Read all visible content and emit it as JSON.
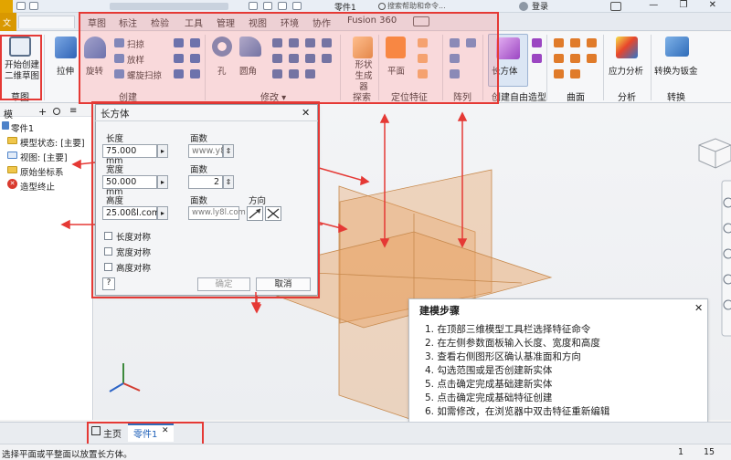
{
  "title_bar": {
    "doc_title": "零件1",
    "search_placeholder": "搜索帮助和命令...",
    "login": "登录",
    "window_controls": "— ❐ ✕"
  },
  "tabs": [
    "草图",
    "标注",
    "检验",
    "工具",
    "管理",
    "视图",
    "环境",
    "协作",
    "Fusion 360"
  ],
  "ribbon": {
    "sketch": {
      "button": "开始创建\n二维草图",
      "group": "草图"
    },
    "create": {
      "extrude": "拉伸",
      "revolve": "旋转",
      "sweep": "扫掠",
      "loft": "放样",
      "coil": "螺旋扫掠",
      "group": "创建"
    },
    "modify": {
      "hole": "孔",
      "fillet": "圆角",
      "group": "修改 ▾"
    },
    "explore": {
      "shape_gen": "形状\n生成器",
      "group": "探索"
    },
    "work": {
      "plane": "平面",
      "group": "定位特征"
    },
    "pattern": {
      "group": "阵列"
    },
    "freeform": {
      "box": "长方体",
      "group": "创建自由造型"
    },
    "surface": {
      "group": "曲面"
    },
    "analysis": {
      "stress": "应力分析",
      "group": "分析"
    },
    "convert": {
      "sheet": "转换为钣金",
      "group": "转换"
    }
  },
  "browser": {
    "tree": [
      {
        "label": "零件1"
      },
      {
        "label": "模型状态: [主要]"
      },
      {
        "label": "视图: [主要]"
      },
      {
        "label": "原始坐标系"
      },
      {
        "label": "造型终止"
      }
    ]
  },
  "dialog": {
    "title": "长方体",
    "length_label": "长度",
    "length_value": "75.000 mm",
    "length_face_label": "面数",
    "length_faces": "www.y8",
    "width_label": "宽度",
    "width_value": "50.000 mm",
    "width_face_label": "面数",
    "width_faces": "2",
    "height_label": "高度",
    "height_value": "25.00ßl.com",
    "height_face_label": "面数",
    "height_faces": "www.ly8l.com",
    "direction_label": "方向",
    "checks": [
      "长度对称",
      "宽度对称",
      "高度对称"
    ],
    "ok": "确定",
    "cancel": "取消"
  },
  "steps": {
    "title": "建模步骤",
    "items": [
      "1. 在顶部三维模型工具栏选择特征命令",
      "2. 在左侧参数面板输入长度、宽度和高度",
      "3. 查看右侧图形区确认基准面和方向",
      "4. 勾选范围或是否创建新实体",
      "5. 点击确定完成基础建新实体",
      "5. 点击确定完成基础特征创建",
      "6. 如需修改，在浏览器中双击特征重新编辑"
    ]
  },
  "doc_tabs": {
    "home": "主页",
    "part": "零件1"
  },
  "status": {
    "text": "选择平面或平整面以放置长方体。",
    "num1": "1",
    "num2": "15"
  },
  "colors": {
    "accent_red": "#e53935",
    "plane_orange": "#e8a060",
    "ribbon_orange": "#f58220"
  }
}
